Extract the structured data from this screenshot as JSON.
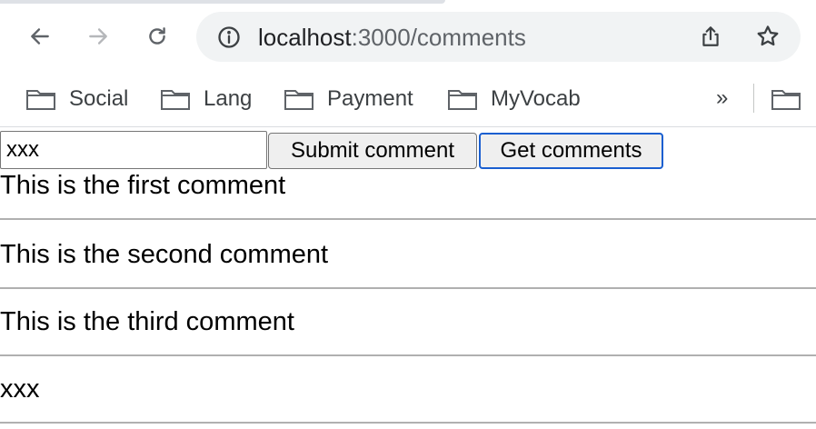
{
  "browser": {
    "url_host": "localhost",
    "url_path": ":3000/comments",
    "bookmarks": [
      {
        "label": "Social"
      },
      {
        "label": "Lang"
      },
      {
        "label": "Payment"
      },
      {
        "label": "MyVocab"
      }
    ],
    "bookmarks_overflow": "»",
    "icons": {
      "back": "arrow-left-icon",
      "forward": "arrow-right-icon",
      "reload": "reload-icon",
      "info": "info-icon",
      "share": "share-icon",
      "bookmark_star": "star-icon",
      "folder": "folder-icon"
    },
    "colors": {
      "omnibox_bg": "#f1f3f4",
      "focus_ring": "#1a5fd0"
    }
  },
  "form": {
    "input_value": "xxx",
    "submit_label": "Submit comment",
    "get_label": "Get comments"
  },
  "comments": [
    "This is the first comment",
    "This is the second comment",
    "This is the third comment",
    "xxx"
  ]
}
